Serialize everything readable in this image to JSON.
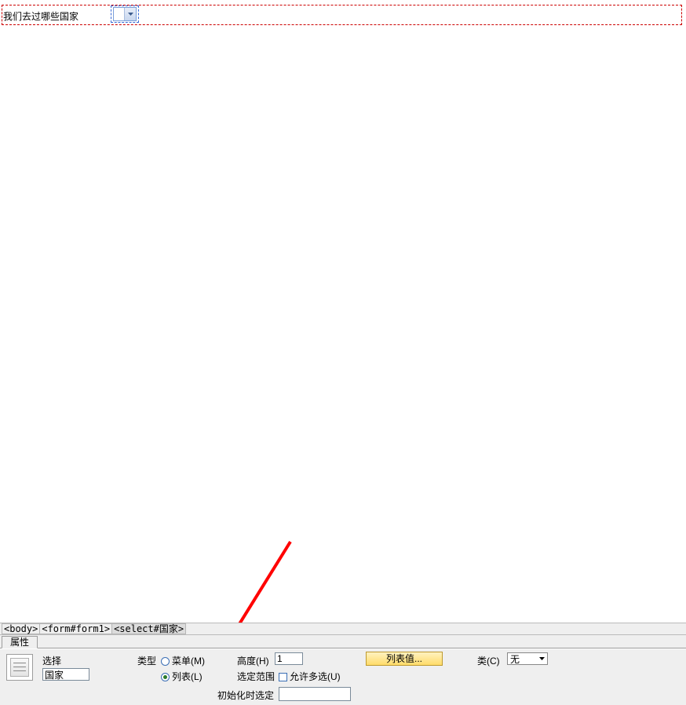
{
  "form": {
    "label_text": "我们去过哪些国家"
  },
  "tagselector": {
    "tags": [
      "<body>",
      "<form#form1>",
      "<select#国家>"
    ]
  },
  "properties": {
    "tab_label": "属性",
    "icon_name": "list-menu-icon",
    "title": "选择",
    "name_value": "国家",
    "type": {
      "label": "类型",
      "menu": "菜单(M)",
      "list": "列表(L)"
    },
    "height": {
      "label": "高度(H)",
      "value": "1"
    },
    "range": {
      "label": "选定范围",
      "multi": "允许多选(U)"
    },
    "listvalues_btn": "列表值...",
    "class": {
      "label": "类(C)",
      "value": "无"
    },
    "init_label": "初始化时选定"
  }
}
